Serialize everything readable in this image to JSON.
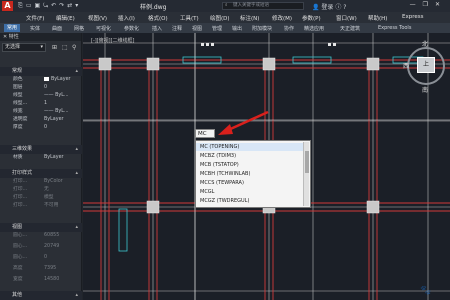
{
  "titlebar": {
    "app_logo": "A",
    "quick_access": [
      "⎘",
      "▭",
      "▣",
      "⤿",
      "↶",
      "↷",
      "⇄",
      "▾"
    ],
    "doc_title": "样例.dwg",
    "search_placeholder": "键入关键字或短语",
    "login": "登录",
    "window_controls": [
      "—",
      "❐",
      "✕"
    ]
  },
  "menubar": [
    "文件(F)",
    "编辑(E)",
    "视图(V)",
    "插入(I)",
    "格式(O)",
    "工具(T)",
    "绘图(D)",
    "标注(N)",
    "修改(M)",
    "参数(P)",
    "窗口(W)",
    "帮助(H)",
    "Express"
  ],
  "ribbon_tabs": [
    "常用",
    "实体",
    "曲面",
    "网格",
    "可视化",
    "参数化",
    "插入",
    "注释",
    "视图",
    "管理",
    "输出",
    "附加模块",
    "协作",
    "精选应用",
    "天正建筑",
    "Express Tools"
  ],
  "ribbon_active": "常用",
  "palette": {
    "title": "特性",
    "selection": "无选择",
    "sections": {
      "general": "常规",
      "threed": "三维效果",
      "print": "打印样式",
      "view": "视图",
      "misc": "其他"
    },
    "general_rows": [
      {
        "k": "颜色",
        "v": "ByLayer"
      },
      {
        "k": "图层",
        "v": "0"
      },
      {
        "k": "线型",
        "v": "—— ByL..."
      },
      {
        "k": "线型...",
        "v": "1"
      },
      {
        "k": "线宽",
        "v": "—— ByL..."
      },
      {
        "k": "透明度",
        "v": "ByLayer"
      },
      {
        "k": "厚度",
        "v": "0"
      }
    ],
    "threed_rows": [
      {
        "k": "材质",
        "v": "ByLayer"
      }
    ],
    "print_rows": [
      {
        "k": "打印...",
        "v": "ByColor"
      },
      {
        "k": "打印...",
        "v": "无"
      },
      {
        "k": "打印...",
        "v": "模型"
      },
      {
        "k": "打印...",
        "v": "不可用"
      }
    ],
    "view_rows": [
      {
        "k": "圆心...",
        "v": "60855"
      },
      {
        "k": "圆心...",
        "v": "20749"
      },
      {
        "k": "圆心...",
        "v": "0"
      },
      {
        "k": "高度",
        "v": "7395"
      },
      {
        "k": "宽度",
        "v": "14580"
      }
    ]
  },
  "canvas": {
    "view_label": "[-][俯视][二维线框]",
    "command_input": "MC",
    "autocomplete": [
      "MC (TOPENING)",
      "MCBZ (TDIM3)",
      "MCB (TSTATOP)",
      "MCBH (TCHWINLAB)",
      "MCCS (TEWPARA)",
      "MCGL",
      "MCGZ (TWDREGUL)"
    ],
    "viewcube": {
      "north": "北",
      "south": "南",
      "face": "上",
      "west": "西"
    },
    "ucs_y": "Y"
  },
  "watermark": "🐾",
  "colors": {
    "accent": "#3e6fa8",
    "arrow": "#d9201c",
    "walls": "#d23a3a",
    "grid": "#c8c8c8"
  }
}
